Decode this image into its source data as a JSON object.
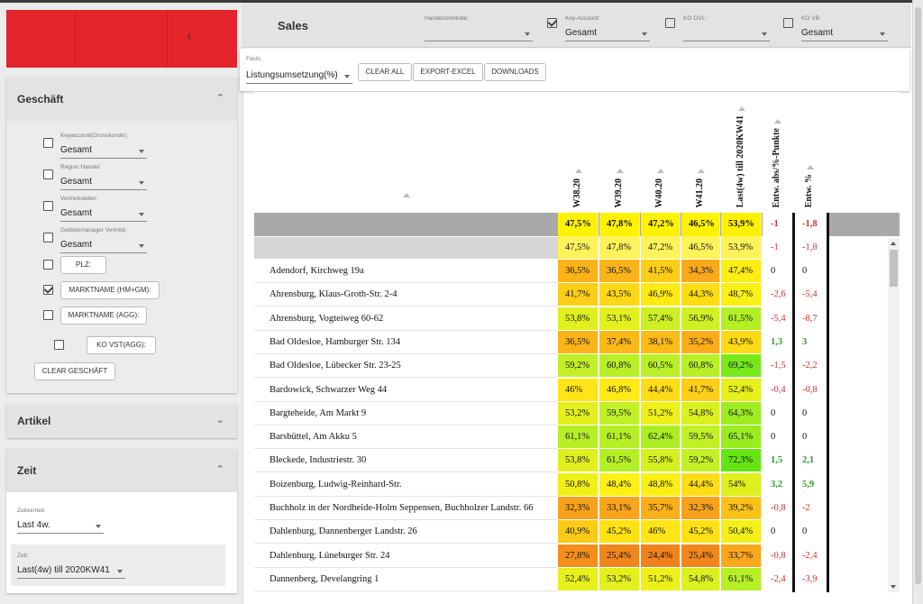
{
  "sidebar": {
    "collapse_icon": "chevron-left",
    "geschaeft": {
      "title": "Geschäft",
      "filters": [
        {
          "label": "Keyaccount(Grosskunde):",
          "value": "Gesamt",
          "checked": false
        },
        {
          "label": "Region Handel:",
          "value": "Gesamt",
          "checked": false
        },
        {
          "label": "Vertriebsleiter:",
          "value": "Gesamt",
          "checked": false
        },
        {
          "label": "Gebietsmanager Vertrieb:",
          "value": "Gesamt",
          "checked": false
        }
      ],
      "buttons": [
        {
          "label": "PLZ:",
          "checked": false
        },
        {
          "label": "MARKTNAME (HM+GM):",
          "checked": true
        },
        {
          "label": "MARKTNAME (AGG):",
          "checked": false
        },
        {
          "label": "KO VST(AGG):",
          "checked": false
        }
      ],
      "clear_label": "CLEAR GESCHÄFT"
    },
    "artikel": {
      "title": "Artikel"
    },
    "zeit": {
      "title": "Zeit",
      "zeiteinheit_label": "Zeiteinheit:",
      "zeiteinheit_value": "Last 4w.",
      "zeit_label": "Zeit:",
      "zeit_value": "Last(4w) till 2020KW41"
    }
  },
  "header": {
    "title": "Sales",
    "handelszentrale_label": "Handelszentrale:",
    "handelszentrale_value": "",
    "key_account_label": "Key-Account:",
    "key_account_value": "Gesamt",
    "key_account_checked": true,
    "ko_gvl_label": "KO GVL:",
    "ko_gvl_value": "",
    "ko_gvl_checked": false,
    "ko_vb_label": "KO VB:",
    "ko_vb_value": "Gesamt",
    "ko_vb_checked": false
  },
  "facts": {
    "label": "Facts:",
    "value": "Listungsumsetzung(%)",
    "clear_all": "CLEAR ALL",
    "export": "EXPORT-EXCEL",
    "downloads": "DOWNLOADS"
  },
  "table": {
    "columns": [
      "W38.20",
      "W39.20",
      "W40.20",
      "W41.20",
      "Last(4w) till 2020KW41",
      "Entw. abs/%-Punkte",
      "Entw. %"
    ],
    "total": [
      "47,5%",
      "47,8%",
      "47,2%",
      "46,5%",
      "53,9%",
      "-1",
      "-1,8"
    ],
    "subtotal": [
      "47,5%",
      "47,8%",
      "47,2%",
      "46,5%",
      "53,9%",
      "-1",
      "-1,8"
    ],
    "rows": [
      {
        "name": "Adendorf, Kirchweg 19a",
        "v": [
          "36,5%",
          "36,5%",
          "41,5%",
          "34,3%",
          "47,4%",
          "0",
          "0"
        ]
      },
      {
        "name": "Ahrensburg, Klaus-Groth-Str. 2-4",
        "v": [
          "41,7%",
          "43,5%",
          "46,9%",
          "44,3%",
          "48,7%",
          "-2,6",
          "-5,4"
        ]
      },
      {
        "name": "Ahrensburg, Vogteiweg 60-62",
        "v": [
          "53,8%",
          "53,1%",
          "57,4%",
          "56,9%",
          "61,5%",
          "-5,4",
          "-8,7"
        ]
      },
      {
        "name": "Bad Oldesloe, Hamburger Str. 134",
        "v": [
          "36,5%",
          "37,4%",
          "38,1%",
          "35,2%",
          "43,9%",
          "1,3",
          "3"
        ]
      },
      {
        "name": "Bad Oldesloe, Lübecker Str. 23-25",
        "v": [
          "59,2%",
          "60,8%",
          "60,5%",
          "60,8%",
          "69,2%",
          "-1,5",
          "-2,2"
        ]
      },
      {
        "name": "Bardowick, Schwarzer Weg 44",
        "v": [
          "46%",
          "46,8%",
          "44,4%",
          "41,7%",
          "52,4%",
          "-0,4",
          "-0,8"
        ]
      },
      {
        "name": "Bargteheide, Am Markt 9",
        "v": [
          "53,2%",
          "59,5%",
          "51,2%",
          "54,8%",
          "64,3%",
          "0",
          "0"
        ]
      },
      {
        "name": "Barsbüttel, Am Akku 5",
        "v": [
          "61,1%",
          "61,1%",
          "62,4%",
          "59,5%",
          "65,1%",
          "0",
          "0"
        ]
      },
      {
        "name": "Bleckede, Industriestr. 30",
        "v": [
          "53,8%",
          "61,5%",
          "55,8%",
          "59,2%",
          "72,3%",
          "1,5",
          "2,1"
        ]
      },
      {
        "name": "Boizenburg, Ludwig-Reinhard-Str.",
        "v": [
          "50,8%",
          "48,4%",
          "48,8%",
          "44,4%",
          "54%",
          "3,2",
          "5,9"
        ]
      },
      {
        "name": "Buchholz in der Nordheide-Holm Seppensen, Buchholzer Landstr. 66",
        "v": [
          "32,3%",
          "33,1%",
          "35,7%",
          "32,3%",
          "39,2%",
          "-0,8",
          "-2"
        ]
      },
      {
        "name": "Dahlenburg, Dannenberger Landstr. 26",
        "v": [
          "40,9%",
          "45,2%",
          "46%",
          "45,2%",
          "50,4%",
          "0",
          "0"
        ]
      },
      {
        "name": "Dahlenburg, Lüneburger Str. 24",
        "v": [
          "27,8%",
          "25,4%",
          "24,4%",
          "25,4%",
          "33,7%",
          "-0,8",
          "-2,4"
        ]
      },
      {
        "name": "Dannenberg, Develangring 1",
        "v": [
          "52,4%",
          "53,2%",
          "51,2%",
          "54,8%",
          "61,1%",
          "-2,4",
          "-3,9"
        ]
      }
    ],
    "colors": {
      "neg": "#d32f2f",
      "pos": "#2e9a2e",
      "zero": "#111111"
    }
  }
}
